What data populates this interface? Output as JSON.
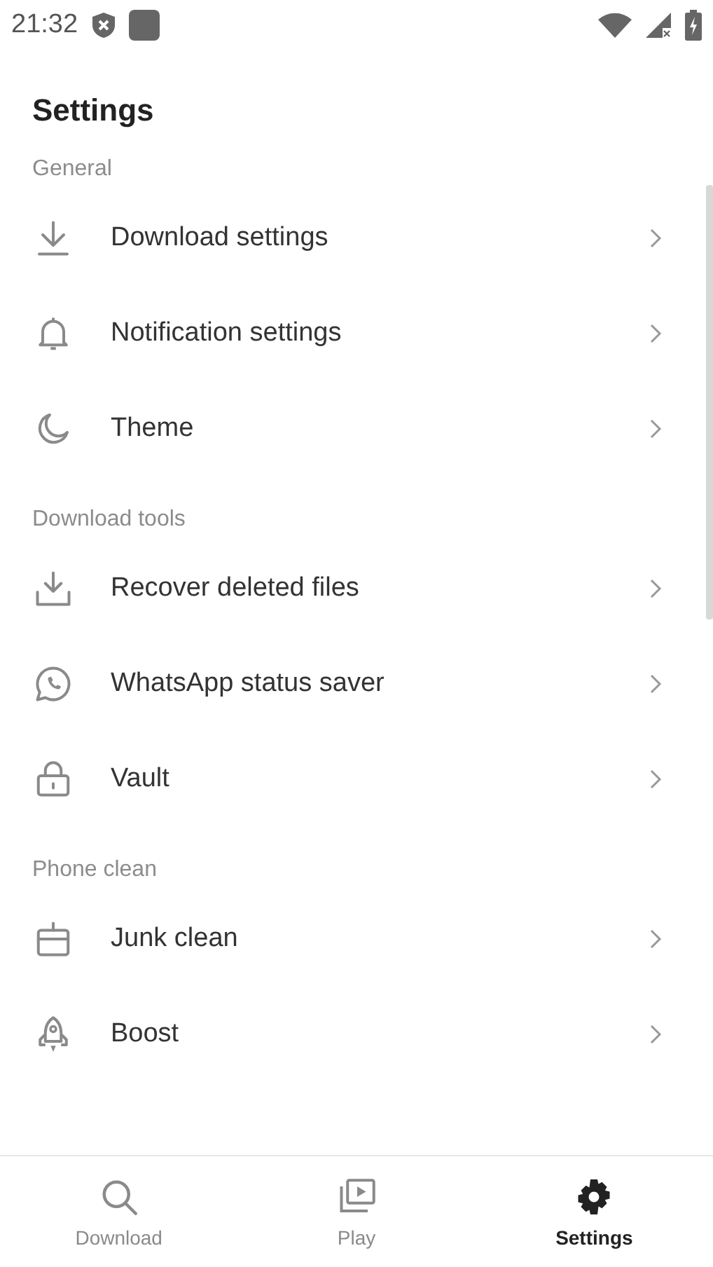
{
  "status_bar": {
    "time": "21:32"
  },
  "title": "Settings",
  "sections": [
    {
      "header": "General",
      "items": [
        {
          "label": "Download settings"
        },
        {
          "label": "Notification settings"
        },
        {
          "label": "Theme"
        }
      ]
    },
    {
      "header": "Download tools",
      "items": [
        {
          "label": "Recover deleted files"
        },
        {
          "label": "WhatsApp status saver"
        },
        {
          "label": "Vault"
        }
      ]
    },
    {
      "header": "Phone clean",
      "items": [
        {
          "label": "Junk clean"
        },
        {
          "label": "Boost"
        }
      ]
    }
  ],
  "bottom_nav": [
    {
      "label": "Download",
      "selected": false
    },
    {
      "label": "Play",
      "selected": false
    },
    {
      "label": "Settings",
      "selected": true
    }
  ]
}
